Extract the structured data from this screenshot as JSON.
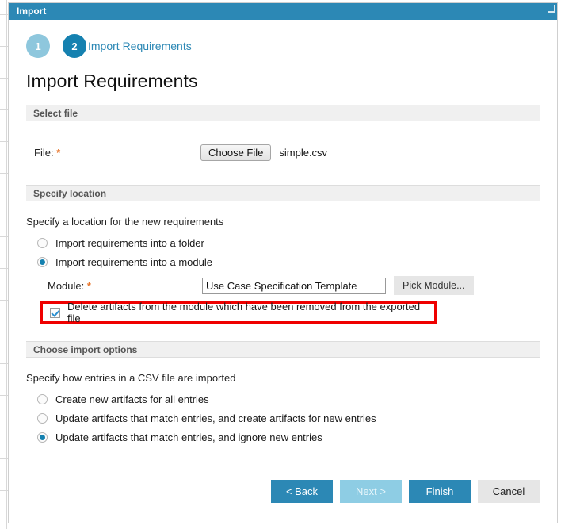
{
  "window": {
    "title": "Import",
    "resize_icon": "resize-grip-icon"
  },
  "wizard": {
    "steps": [
      {
        "number": "1",
        "label": "",
        "state": "completed"
      },
      {
        "number": "2",
        "label": "Import Requirements",
        "state": "current"
      }
    ],
    "page_title": "Import Requirements"
  },
  "sections": {
    "select_file": {
      "header": "Select file",
      "file_label": "File:",
      "required_marker": "*",
      "choose_file_button": "Choose File",
      "file_name": "simple.csv"
    },
    "specify_location": {
      "header": "Specify location",
      "hint": "Specify a location for the new requirements",
      "options": [
        {
          "label": "Import requirements into a folder",
          "selected": false
        },
        {
          "label": "Import requirements into a module",
          "selected": true
        }
      ],
      "module_label": "Module:",
      "module_required_marker": "*",
      "module_value": "Use Case Specification Template",
      "pick_module_button": "Pick Module...",
      "delete_checkbox": {
        "label": "Delete artifacts from the module which have been removed from the exported file",
        "checked": true,
        "highlight_color": "#ef0000"
      }
    },
    "import_options": {
      "header": "Choose import options",
      "hint": "Specify how entries in a CSV file are imported",
      "options": [
        {
          "label": "Create new artifacts for all entries",
          "selected": false
        },
        {
          "label": "Update artifacts that match entries, and create artifacts for new entries",
          "selected": false
        },
        {
          "label": "Update artifacts that match entries, and ignore new entries",
          "selected": true
        }
      ]
    }
  },
  "footer": {
    "back": "< Back",
    "next": "Next >",
    "finish": "Finish",
    "cancel": "Cancel"
  },
  "colors": {
    "accent": "#2c88b5",
    "accent_light": "#8ecde4",
    "step_done": "#8ec7dd",
    "step_current": "#1581b0",
    "required": "#e8762c",
    "highlight": "#ef0000"
  }
}
